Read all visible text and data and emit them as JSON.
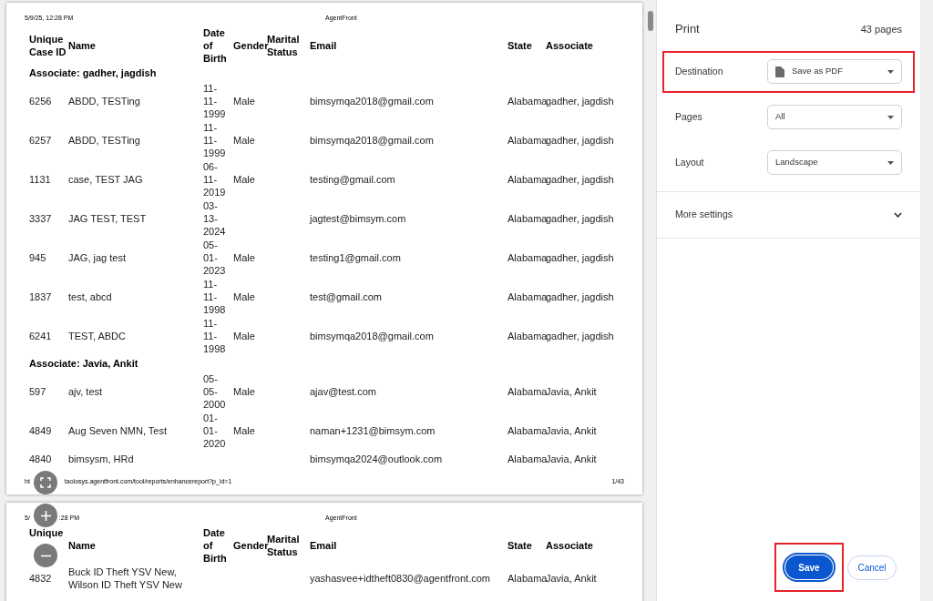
{
  "preview": {
    "pages": [
      {
        "header_date_parts": [
          "5/9/25, 12:28 PM"
        ],
        "header_title": "AgentFront",
        "columns": [
          "Unique Case ID",
          "Name",
          "Date of Birth",
          "Gender",
          "Marital Status",
          "Email",
          "State",
          "Associate"
        ],
        "groups": [
          {
            "label": "Associate: gadher, jagdish",
            "rows": [
              {
                "id": "6256",
                "name": "ABDD, TESTing",
                "dob": "11-11-1999",
                "gender": "Male",
                "email": "bimsymqa2018@gmail.com",
                "state": "Alabama",
                "associate": "gadher, jagdish"
              },
              {
                "id": "6257",
                "name": "ABDD, TESTing",
                "dob": "11-11-1999",
                "gender": "Male",
                "email": "bimsymqa2018@gmail.com",
                "state": "Alabama",
                "associate": "gadher, jagdish"
              },
              {
                "id": "1131",
                "name": "case, TEST JAG",
                "dob": "06-11-2019",
                "gender": "Male",
                "email": "testing@gmail.com",
                "state": "Alabama",
                "associate": "gadher, jagdish"
              },
              {
                "id": "3337",
                "name": "JAG TEST, TEST",
                "dob": "03-13-2024",
                "email": "jagtest@bimsym.com",
                "state": "Alabama",
                "associate": "gadher, jagdish"
              },
              {
                "id": "945",
                "name": "JAG, jag test",
                "dob": "05-01-2023",
                "gender": "Male",
                "email": "testing1@gmail.com",
                "state": "Alabama",
                "associate": "gadher, jagdish"
              },
              {
                "id": "1837",
                "name": "test, abcd",
                "dob": "11-11-1998",
                "gender": "Male",
                "email": "test@gmail.com",
                "state": "Alabama",
                "associate": "gadher, jagdish"
              },
              {
                "id": "6241",
                "name": "TEST, ABDC",
                "dob": "11-11-1998",
                "gender": "Male",
                "email": "bimsymqa2018@gmail.com",
                "state": "Alabama",
                "associate": "gadher, jagdish"
              }
            ]
          },
          {
            "label": "Associate: Javia, Ankit",
            "rows": [
              {
                "id": "597",
                "name": "ajv, test",
                "dob": "05-05-2000",
                "gender": "Male",
                "email": "ajav@test.com",
                "state": "Alabama",
                "associate": "Javia, Ankit"
              },
              {
                "id": "4849",
                "name": "Aug Seven NMN, Test",
                "dob": "01-01-2020",
                "gender": "Male",
                "email": "naman+1231@bimsym.com",
                "state": "Alabama",
                "associate": "Javia, Ankit"
              },
              {
                "id": "4840",
                "name": "bimsysm, HRd",
                "email": "bimsymqa2024@outlook.com",
                "state": "Alabama",
                "associate": "Javia, Ankit"
              }
            ]
          }
        ],
        "footer_url_parts": [
          "ht",
          "taolosys.agentfront.com/tool/reports/enhancereport?p_id=1"
        ],
        "page_number": "1/43"
      },
      {
        "header_date_parts": [
          "5/",
          ":28 PM"
        ],
        "header_title": "AgentFront",
        "columns": [
          "Unique",
          "Name",
          "Date of Birth",
          "Gender",
          "Marital Status",
          "Email",
          "State",
          "Associate"
        ],
        "groups": [
          {
            "rows": [
              {
                "id": "4832",
                "name": "Buck ID Theft YSV New, Wilson ID Theft YSV New",
                "email": "yashasvee+idtheft0830@agentfront.com",
                "state": "Alabama",
                "associate": "Javia, Ankit"
              }
            ]
          }
        ]
      }
    ]
  },
  "print_panel": {
    "title": "Print",
    "page_count": "43 pages",
    "settings": [
      {
        "label": "Destination",
        "value": "Save as PDF",
        "has_icon": true,
        "highlighted": true
      },
      {
        "label": "Pages",
        "value": "All",
        "has_icon": false,
        "highlighted": false
      },
      {
        "label": "Layout",
        "value": "Landscape",
        "has_icon": false,
        "highlighted": false
      }
    ],
    "more_settings": {
      "label": "More settings",
      "expanded": false
    },
    "buttons": [
      {
        "label": "Save",
        "kind": "primary",
        "highlighted": true
      },
      {
        "label": "Cancel",
        "kind": "secondary",
        "highlighted": false
      }
    ]
  }
}
